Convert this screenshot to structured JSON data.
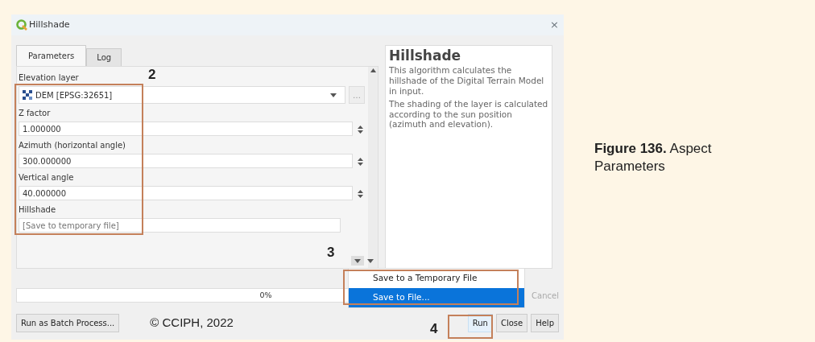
{
  "dialog": {
    "title": "Hillshade",
    "close_glyph": "×",
    "browse_glyph": "…",
    "tabs": [
      {
        "label": "Parameters",
        "selected": true
      },
      {
        "label": "Log",
        "selected": false
      }
    ],
    "parameters": [
      {
        "label": "Elevation layer",
        "kind": "layer",
        "value": "DEM [EPSG:32651]"
      },
      {
        "label": "Z factor",
        "kind": "number",
        "value": "1.000000"
      },
      {
        "label": "Azimuth (horizontal angle)",
        "kind": "number",
        "value": "300.000000"
      },
      {
        "label": "Vertical angle",
        "kind": "number",
        "value": "40.000000"
      },
      {
        "label": "Hillshade",
        "kind": "output",
        "placeholder": "[Save to temporary file]"
      }
    ],
    "output_menu": [
      {
        "label": "Save to a Temporary File",
        "selected": false
      },
      {
        "label": "Save to File...",
        "selected": true
      }
    ],
    "help": {
      "title": "Hillshade",
      "paragraphs": [
        "This algorithm calculates the hillshade of the Digital Terrain Model in input.",
        "The shading of the layer is calculated according to the sun position (azimuth and elevation)."
      ]
    },
    "progress": {
      "level": 0,
      "reading": "0%"
    },
    "cancel": {
      "label": "Cancel",
      "disabled": true
    },
    "batch_button": "Run as Batch Process...",
    "copyright": "© CCIPH, 2022",
    "buttons": [
      "Run",
      "Close",
      "Help"
    ],
    "callouts": [
      "2",
      "3",
      "4"
    ]
  },
  "caption": {
    "label": "Figure 136.",
    "text": "Aspect Parameters"
  }
}
